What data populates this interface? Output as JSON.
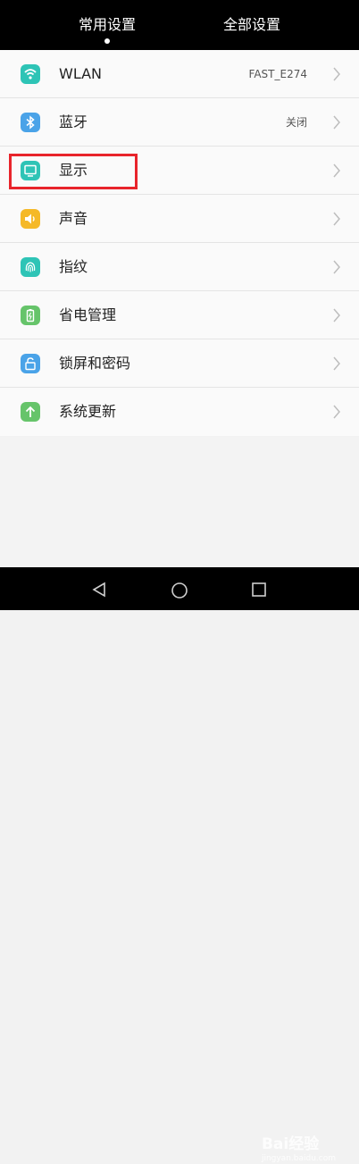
{
  "tabs": {
    "common": "常用设置",
    "all": "全部设置"
  },
  "settings": [
    {
      "label": "WLAN",
      "value": "FAST_E274",
      "icon": "wifi-icon",
      "color": "#2ec4b6"
    },
    {
      "label": "蓝牙",
      "value": "关闭",
      "icon": "bluetooth-icon",
      "color": "#4aa3e8"
    },
    {
      "label": "显示",
      "value": "",
      "icon": "display-icon",
      "color": "#2ec4b6"
    },
    {
      "label": "声音",
      "value": "",
      "icon": "sound-icon",
      "color": "#f5b928"
    },
    {
      "label": "指纹",
      "value": "",
      "icon": "fingerprint-icon",
      "color": "#2ec4b6"
    },
    {
      "label": "省电管理",
      "value": "",
      "icon": "battery-icon",
      "color": "#66c46a"
    },
    {
      "label": "锁屏和密码",
      "value": "",
      "icon": "lock-icon",
      "color": "#4aa3e8"
    },
    {
      "label": "系统更新",
      "value": "",
      "icon": "update-icon",
      "color": "#66c46a"
    }
  ],
  "watermark": {
    "brand": "Bai经验",
    "url": "jingyan.baidu.com"
  },
  "colors": {
    "highlight": "#e8242b"
  }
}
